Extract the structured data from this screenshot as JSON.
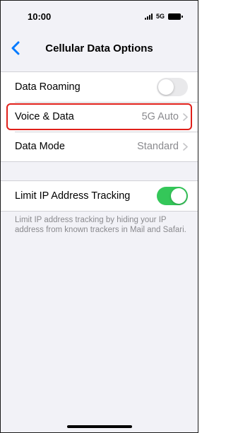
{
  "status_bar": {
    "time": "10:00",
    "network": "5G"
  },
  "nav": {
    "title": "Cellular Data Options",
    "back_icon": "chevron-left-icon"
  },
  "settings": [
    {
      "label": "Data Roaming",
      "type": "toggle",
      "state": "off"
    },
    {
      "label": "Voice & Data",
      "type": "disclosure",
      "value": "5G Auto",
      "highlighted": true
    },
    {
      "label": "Data Mode",
      "type": "disclosure",
      "value": "Standard"
    }
  ],
  "privacy": {
    "label": "Limit IP Address Tracking",
    "state": "on",
    "footer": "Limit IP address tracking by hiding your IP address from known trackers in Mail and Safari."
  },
  "colors": {
    "accent": "#007aff",
    "toggle_on": "#34c759",
    "highlight": "#e0201a"
  }
}
